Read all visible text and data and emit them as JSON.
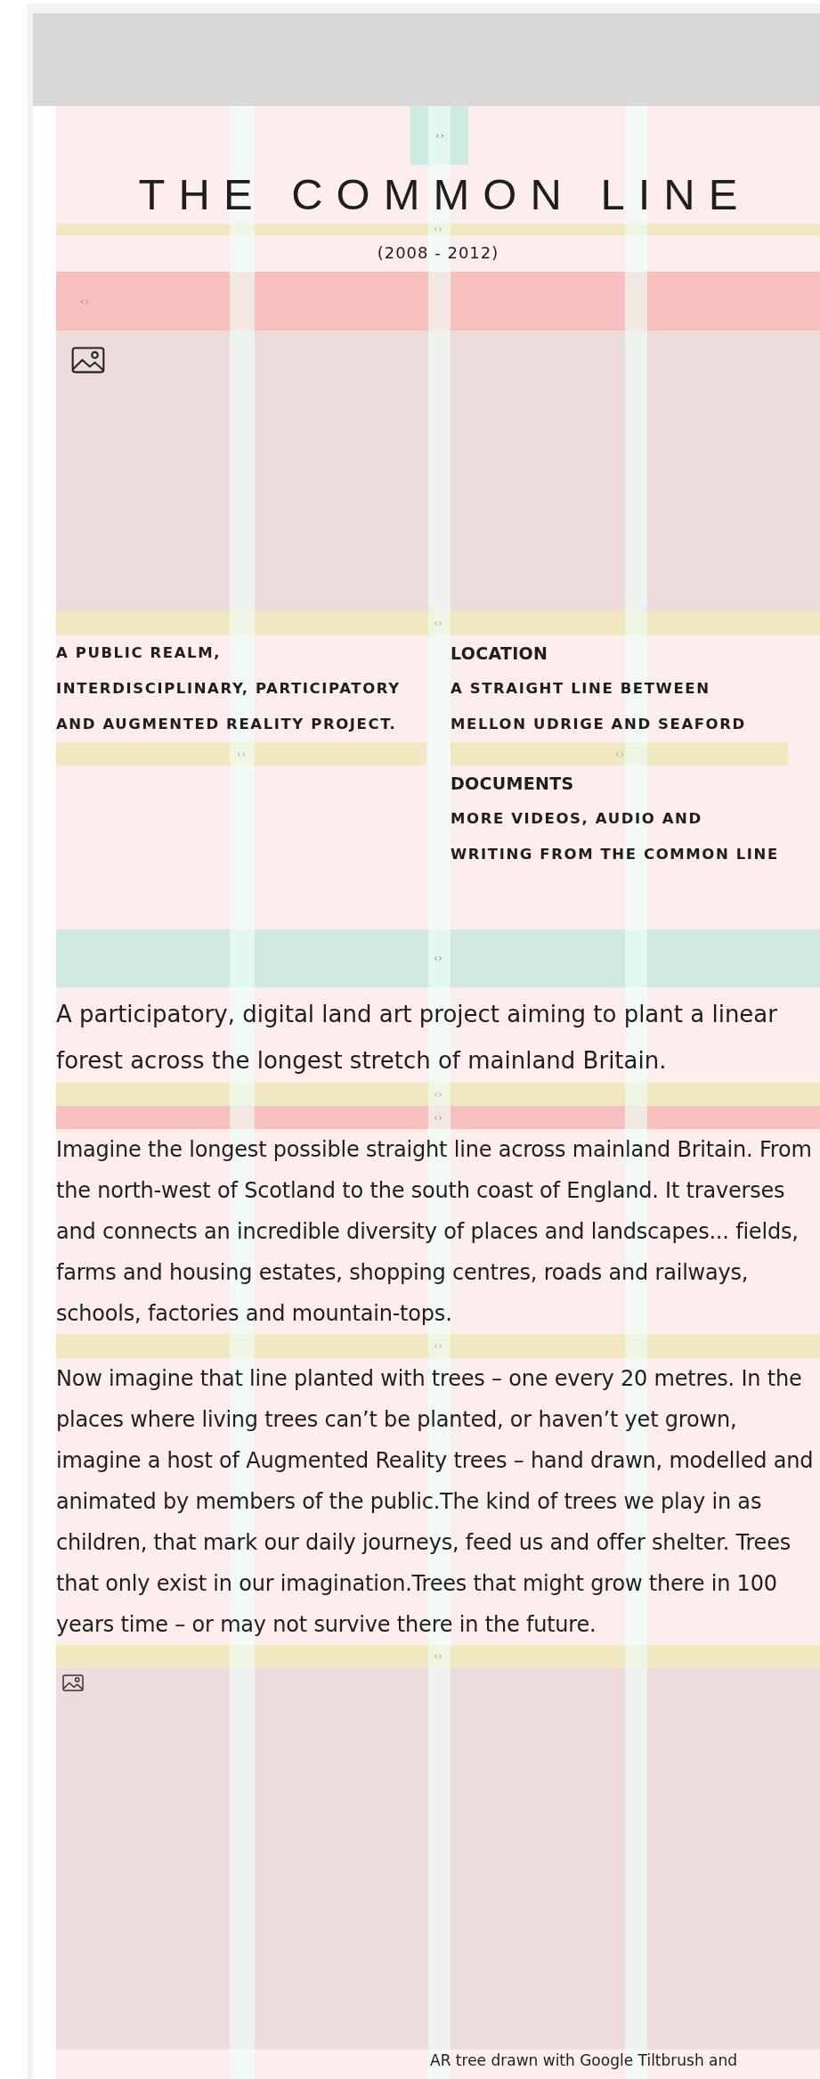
{
  "header": {
    "title": "THE COMMON LINE",
    "dates": "(2008 - 2012)"
  },
  "intro": {
    "tagline": "A PUBLIC REALM, INTERDISCIPLINARY, PARTICIPATORY AND AUGMENTED REALITY PROJECT.",
    "sections": [
      {
        "heading": "LOCATION",
        "text": "A STRAIGHT LINE BETWEEN MELLON UDRIGE AND SEAFORD"
      },
      {
        "heading": "DOCUMENTS",
        "text": "MORE VIDEOS, AUDIO AND WRITING FROM THE COMMON LINE"
      }
    ]
  },
  "lead": "A participatory, digital land art project aiming to plant a linear forest across the longest stretch of mainland Britain.",
  "paragraphs": [
    "Imagine the longest possible straight line across mainland Britain. From the north-west of Scotland to the south coast of England. It traverses and connects an incredible diversity of places and landscapes... fields, farms and housing estates, shopping centres, roads and railways, schools, factories and mountain-tops.",
    "Now imagine that line planted with trees – one every 20 metres. In the places where living trees can’t be planted, or haven’t yet grown, imagine a host of Augmented Reality trees – hand drawn, modelled and animated by members of the public.The kind of trees we play in as children, that mark our daily journeys, feed us and offer shelter. Trees that only exist in our imagination.Trees that might grow there in 100 years time – or may not survive there in the future."
  ],
  "caption": "AR tree drawn with Google Tiltbrush and"
}
